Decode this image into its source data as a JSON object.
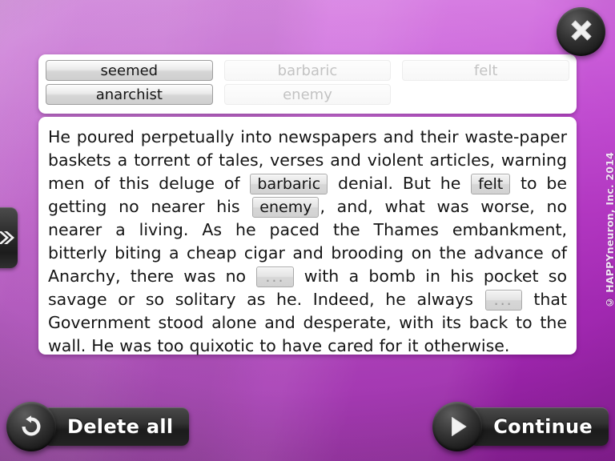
{
  "app": {
    "copyright": "© HAPPYneuron, Inc. 2014",
    "accent_purple": "#b033bf",
    "panel_bg": "#ffffff"
  },
  "close_button": {
    "icon": "close-icon",
    "label": "Close"
  },
  "left_tab": {
    "icon": "double-chevron-right-icon",
    "label": "»"
  },
  "word_bank": {
    "rows": [
      [
        {
          "label": "seemed",
          "state": "available"
        },
        {
          "label": "barbaric",
          "state": "used"
        },
        {
          "label": "felt",
          "state": "used"
        }
      ],
      [
        {
          "label": "anarchist",
          "state": "available"
        },
        {
          "label": "enemy",
          "state": "used"
        },
        {
          "label": "",
          "state": "empty"
        }
      ]
    ]
  },
  "passage": {
    "tokens": [
      {
        "t": "text",
        "v": "He poured perpetually into newspapers and their waste-paper baskets a torrent of tales, verses and violent articles, warning men of this deluge of "
      },
      {
        "t": "chip",
        "v": "barbaric"
      },
      {
        "t": "text",
        "v": " denial. But he "
      },
      {
        "t": "chip",
        "v": "felt"
      },
      {
        "t": "text",
        "v": " to be getting no nearer his "
      },
      {
        "t": "chip",
        "v": "enemy"
      },
      {
        "t": "text",
        "v": ", and, what was worse, no nearer a living. As he paced the Thames embankment, bitterly biting a cheap cigar and brooding on the advance of Anarchy, there was no "
      },
      {
        "t": "blank",
        "v": "..."
      },
      {
        "t": "text",
        "v": " with a bomb in his pocket so savage or so solitary as he. Indeed, he always "
      },
      {
        "t": "blank",
        "v": "..."
      },
      {
        "t": "text",
        "v": " that Government stood alone and desperate, with its back to the wall. He was too quixotic to have cared for it otherwise."
      }
    ]
  },
  "footer": {
    "delete_all": {
      "label": "Delete all",
      "icon": "undo-circular-arrow-icon"
    },
    "continue": {
      "label": "Continue",
      "icon": "play-triangle-icon"
    }
  }
}
